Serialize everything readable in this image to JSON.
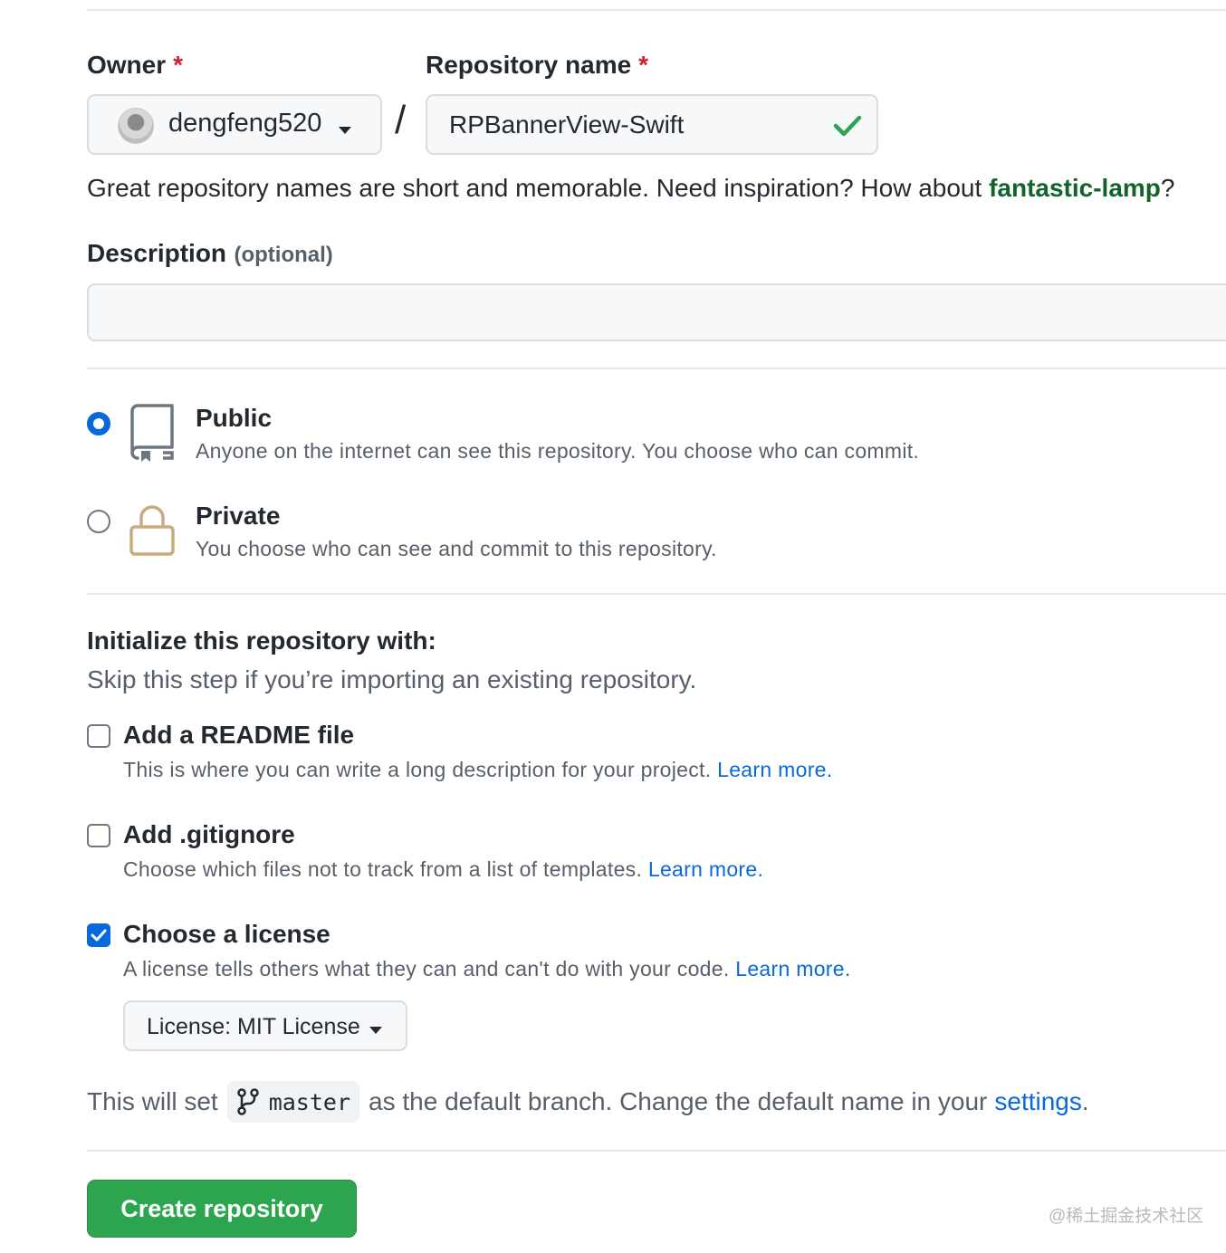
{
  "owner": {
    "label": "Owner",
    "required_mark": "*",
    "value": "dengfeng520"
  },
  "separator": "/",
  "repo_name": {
    "label": "Repository name",
    "required_mark": "*",
    "value": "RPBannerView-Swift"
  },
  "hint": {
    "text": "Great repository names are short and memorable. Need inspiration? How about ",
    "suggestion": "fantastic-lamp",
    "suffix": "?"
  },
  "description": {
    "label": "Description",
    "optional": "(optional)",
    "value": ""
  },
  "visibility": {
    "selected": "public",
    "public": {
      "title": "Public",
      "desc": "Anyone on the internet can see this repository. You choose who can commit."
    },
    "private": {
      "title": "Private",
      "desc": "You choose who can see and commit to this repository."
    }
  },
  "init": {
    "heading": "Initialize this repository with:",
    "subheading": "Skip this step if you’re importing an existing repository.",
    "readme": {
      "title": "Add a README file",
      "desc": "This is where you can write a long description for your project. ",
      "link": "Learn more.",
      "checked": false
    },
    "gitignore": {
      "title": "Add .gitignore",
      "desc": "Choose which files not to track from a list of templates. ",
      "link": "Learn more.",
      "checked": false
    },
    "license": {
      "title": "Choose a license",
      "desc": "A license tells others what they can and can't do with your code. ",
      "link": "Learn more.",
      "checked": true,
      "dropdown": "License: MIT License"
    }
  },
  "branch": {
    "prefix": "This will set",
    "name": "master",
    "middle": "as the default branch. Change the default name in your",
    "link": "settings",
    "suffix": "."
  },
  "submit": {
    "label": "Create repository"
  },
  "watermark": "@稀土掘金技术社区",
  "colors": {
    "accent": "#0969da",
    "success": "#2da44e",
    "suggestion": "#116329",
    "danger": "#cf222e"
  }
}
